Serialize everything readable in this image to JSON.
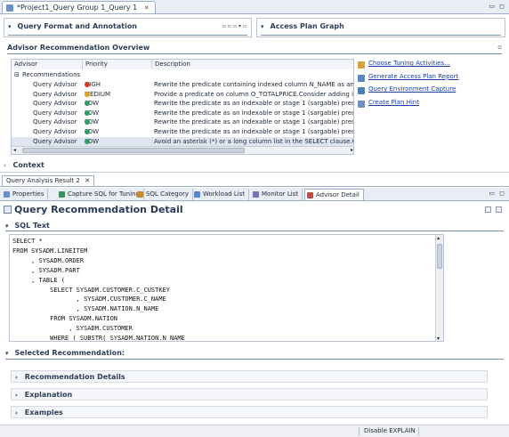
{
  "editor_tab": {
    "label": "*Project1_Query Group 1_Query 1"
  },
  "panels": {
    "query_format": "Query Format and Annotation",
    "access_plan": "Access Plan Graph",
    "advisor_overview": "Advisor Recommendation Overview",
    "context": "Context"
  },
  "grid": {
    "columns": [
      "Advisor",
      "Priority",
      "Description"
    ],
    "group_label": "Recommendations",
    "rows": [
      {
        "advisor": "Query Advisor",
        "priority": "HIGH",
        "color": "#d23a2a",
        "description": "Rewrite the predicate containing indexed column N_NAME as an i"
      },
      {
        "advisor": "Query Advisor",
        "priority": "MEDIUM",
        "color": "#e0a020",
        "description": "Provide a predicate on column O_TOTALPRICE.Consider adding it"
      },
      {
        "advisor": "Query Advisor",
        "priority": "LOW",
        "color": "#2f9a62",
        "description": "Rewrite the predicate as an indexable or stage 1 (sargable) pred"
      },
      {
        "advisor": "Query Advisor",
        "priority": "LOW",
        "color": "#2f9a62",
        "description": "Rewrite the predicate as an indexable or stage 1 (sargable) pred"
      },
      {
        "advisor": "Query Advisor",
        "priority": "LOW",
        "color": "#2f9a62",
        "description": "Rewrite the predicate as an indexable or stage 1 (sargable) pred"
      },
      {
        "advisor": "Query Advisor",
        "priority": "LOW",
        "color": "#2f9a62",
        "description": "Rewrite the predicate as an indexable or stage 1 (sargable) pred"
      },
      {
        "advisor": "Query Advisor",
        "priority": "LOW",
        "color": "#2f9a62",
        "description": "Avoid an asterisk (*) or a long column list in the SELECT clause.C"
      }
    ]
  },
  "actions": [
    {
      "label": "Choose Tuning Activities...",
      "color": "#d9a23a"
    },
    {
      "label": "Generate Access Plan Report",
      "color": "#5b87c9"
    },
    {
      "label": "Query Environment Capture",
      "color": "#4d7fb8"
    },
    {
      "label": "Create Plan Hint",
      "color": "#6b8fc6"
    }
  ],
  "result_tab": "Query Analysis Result 2",
  "bottom_tabs": [
    {
      "label": "Properties",
      "color": "#6b8fc6"
    },
    {
      "label": "Capture SQL for Tuning",
      "color": "#3f8f5c"
    },
    {
      "label": "SQL Category",
      "color": "#c48b2c"
    },
    {
      "label": "Workload List",
      "color": "#5b87c9"
    },
    {
      "label": "Monitor List",
      "color": "#7a6fb5"
    },
    {
      "label": "Advisor Detail",
      "color": "#c44a3a"
    }
  ],
  "detail": {
    "title": "Query Recommendation Detail",
    "sql_section": "SQL Text",
    "sql_lines": [
      "SELECT *",
      "FROM SYSADM.LINEITEM",
      "     , SYSADM.ORDER",
      "     , SYSADM.PART",
      "     , TABLE (",
      "          SELECT SYSADM.CUSTOMER.C_CUSTKEY",
      "                 , SYSADM.CUSTOMER.C_NAME",
      "                 , SYSADM.NATION.N_NAME",
      "          FROM SYSADM.NATION",
      "               , SYSADM.CUSTOMER",
      "          WHERE ( SUBSTR( SYSADM.NATION.N_NAME"
    ],
    "selected_section": "Selected Recommendation:",
    "subsections": [
      "Recommendation Details",
      "Explanation",
      "Examples"
    ]
  },
  "status": {
    "text": "Disable EXPLAIN"
  }
}
